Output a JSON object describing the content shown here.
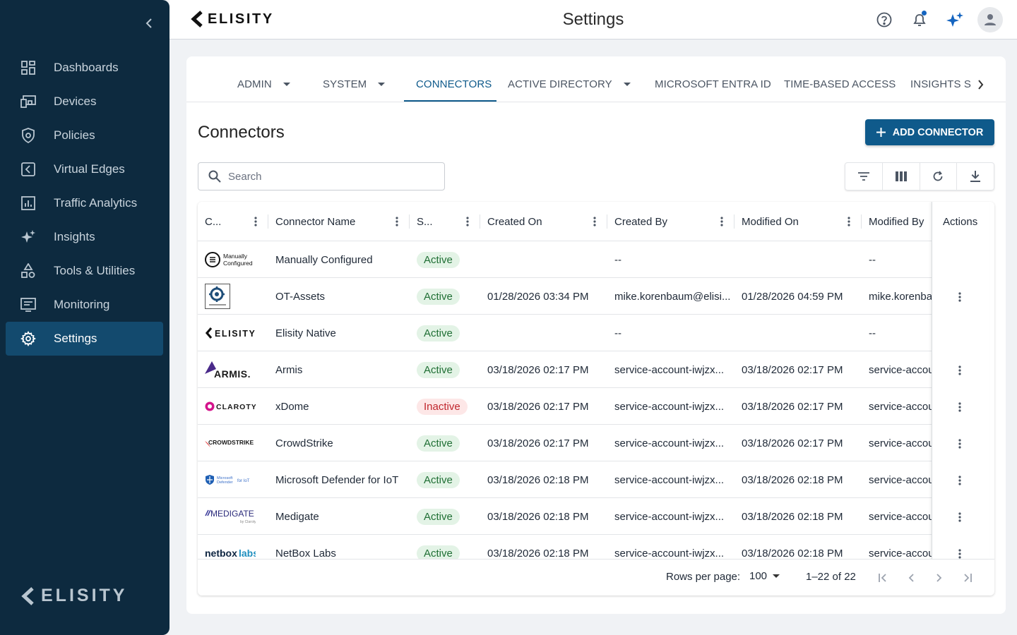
{
  "sidebar": {
    "items": [
      {
        "label": "Dashboards",
        "icon": "dashboard-icon"
      },
      {
        "label": "Devices",
        "icon": "devices-icon"
      },
      {
        "label": "Policies",
        "icon": "shield-icon"
      },
      {
        "label": "Virtual Edges",
        "icon": "virtual-edge-icon"
      },
      {
        "label": "Traffic Analytics",
        "icon": "analytics-icon"
      },
      {
        "label": "Insights",
        "icon": "sparkle-icon"
      },
      {
        "label": "Tools & Utilities",
        "icon": "tools-icon"
      },
      {
        "label": "Monitoring",
        "icon": "monitor-icon"
      },
      {
        "label": "Settings",
        "icon": "gear-icon"
      }
    ],
    "active_item": "Settings",
    "logo_text": "ELISITY"
  },
  "topbar": {
    "brand": "ELISITY",
    "title": "Settings"
  },
  "tabs": [
    {
      "label": "ADMIN",
      "dropdown": true
    },
    {
      "label": "SYSTEM",
      "dropdown": true
    },
    {
      "label": "CONNECTORS",
      "dropdown": false,
      "active": true
    },
    {
      "label": "ACTIVE DIRECTORY",
      "dropdown": true
    },
    {
      "label": "MICROSOFT ENTRA ID",
      "dropdown": false
    },
    {
      "label": "TIME-BASED ACCESS",
      "dropdown": false
    },
    {
      "label": "INSIGHTS S",
      "dropdown": false
    }
  ],
  "section": {
    "title": "Connectors",
    "add_button": "ADD CONNECTOR",
    "search_placeholder": "Search"
  },
  "table": {
    "columns": [
      "C...",
      "Connector Name",
      "S...",
      "Created On",
      "Created By",
      "Modified On",
      "Modified By",
      "Actions"
    ],
    "rows": [
      {
        "logo": "Manually Configured",
        "name": "Manually Configured",
        "status": "Active",
        "created_on": "",
        "created_by": "--",
        "modified_on": "",
        "modified_by": "--",
        "has_actions": false
      },
      {
        "logo": "OT-Assets",
        "name": "OT-Assets",
        "status": "Active",
        "created_on": "01/28/2026 03:34 PM",
        "created_by": "mike.korenbaum@elisi...",
        "modified_on": "01/28/2026 04:59 PM",
        "modified_by": "mike.korenbaum",
        "has_actions": true
      },
      {
        "logo": "ELISITY",
        "name": "Elisity Native",
        "status": "Active",
        "created_on": "",
        "created_by": "--",
        "modified_on": "",
        "modified_by": "--",
        "has_actions": false
      },
      {
        "logo": "ARMIS.",
        "name": "Armis",
        "status": "Active",
        "created_on": "03/18/2026 02:17 PM",
        "created_by": "service-account-iwjzx...",
        "modified_on": "03/18/2026 02:17 PM",
        "modified_by": "service-account",
        "has_actions": true
      },
      {
        "logo": "CLAROTY",
        "name": "xDome",
        "status": "Inactive",
        "created_on": "03/18/2026 02:17 PM",
        "created_by": "service-account-iwjzx...",
        "modified_on": "03/18/2026 02:17 PM",
        "modified_by": "service-account",
        "has_actions": true
      },
      {
        "logo": "CROWDSTRIKE",
        "name": "CrowdStrike",
        "status": "Active",
        "created_on": "03/18/2026 02:17 PM",
        "created_by": "service-account-iwjzx...",
        "modified_on": "03/18/2026 02:17 PM",
        "modified_by": "service-account",
        "has_actions": true
      },
      {
        "logo": "Microsoft Defender for IoT",
        "name": "Microsoft Defender for IoT",
        "status": "Active",
        "created_on": "03/18/2026 02:18 PM",
        "created_by": "service-account-iwjzx...",
        "modified_on": "03/18/2026 02:18 PM",
        "modified_by": "service-account",
        "has_actions": true
      },
      {
        "logo": "MEDIGATE",
        "name": "Medigate",
        "status": "Active",
        "created_on": "03/18/2026 02:18 PM",
        "created_by": "service-account-iwjzx...",
        "modified_on": "03/18/2026 02:18 PM",
        "modified_by": "service-account",
        "has_actions": true
      },
      {
        "logo": "netboxlabs",
        "name": "NetBox Labs",
        "status": "Active",
        "created_on": "03/18/2026 02:18 PM",
        "created_by": "service-account-iwjzx...",
        "modified_on": "03/18/2026 02:18 PM",
        "modified_by": "service-account",
        "has_actions": true
      }
    ]
  },
  "pagination": {
    "rows_per_page_label": "Rows per page:",
    "rows_per_page": "100",
    "range": "1–22 of 22"
  },
  "colors": {
    "sidebar_bg": "#0d2a3f",
    "accent": "#0f5a8b",
    "active_chip": "#1f6f34",
    "inactive_chip": "#c0262d"
  }
}
